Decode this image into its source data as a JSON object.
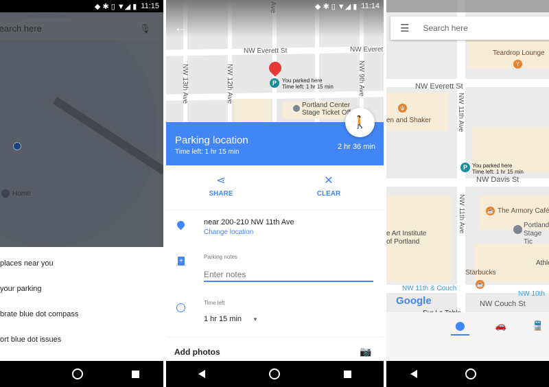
{
  "colors": {
    "accent": "#4285f4",
    "parking": "#1b8e9e",
    "poi_orange": "#e8812b",
    "pin": "#e53935"
  },
  "panel1": {
    "status": {
      "time": "11:15"
    },
    "search": {
      "placeholder": "Search here",
      "mic_icon": "mic-icon"
    },
    "map": {
      "home_label": "Home"
    },
    "menu": [
      "places near you",
      "your parking",
      "brate blue dot compass",
      "ort blue dot issues"
    ]
  },
  "panel2": {
    "status": {
      "time": "11:14"
    },
    "map": {
      "streets": [
        "NW Everett St",
        "NW Everett",
        "NW 13th Ave",
        "NW 12th Ave",
        "NW 9th Ave",
        "Ave"
      ],
      "marker_line1": "You parked here",
      "marker_line2": "Time left: 1 hr 15 min",
      "poi": "Portland Center",
      "poi2": "Stage Ticket Off"
    },
    "header": {
      "title": "Parking location",
      "subtitle": "Time left: 1 hr 15 min",
      "walk_time": "2 hr 36 min"
    },
    "actions": {
      "share": "SHARE",
      "clear": "CLEAR"
    },
    "location": {
      "address": "near 200-210 NW 11th Ave",
      "change": "Change location"
    },
    "notes": {
      "label": "Parking notes",
      "placeholder": "Enter notes"
    },
    "time_left": {
      "label": "Time left",
      "value": "1 hr 15 min"
    },
    "add_photos": "Add photos"
  },
  "panel3": {
    "search": {
      "placeholder": "Search here"
    },
    "map": {
      "streets": [
        "NW Everett St",
        "NW 11th Ave",
        "NW 11th Ave",
        "NW Davis St",
        "NW Couch St",
        "NW 10th"
      ],
      "places": [
        "Teardrop Lounge",
        "en and Shaker",
        "The Armory Café",
        "Portland",
        "Stage Tic",
        "e Art Institute",
        "of Portland",
        "Athle",
        "Starbucks",
        "NW 11th & Couch",
        "Sur La Table"
      ],
      "marker_line1": "You parked here",
      "marker_line2": "Time left: 1 hr 15 min",
      "logo": "Google"
    },
    "tabs": [
      {
        "icon": "explore-pin-icon",
        "active": true
      },
      {
        "icon": "car-icon",
        "active": false
      },
      {
        "icon": "transit-icon",
        "active": false
      }
    ]
  }
}
